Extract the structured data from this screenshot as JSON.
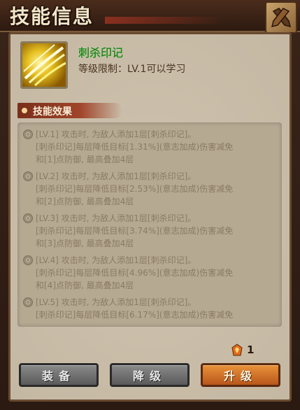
{
  "window": {
    "title": "技能信息"
  },
  "skill": {
    "name": "刺杀印记",
    "level_requirement": "等级限制：LV.1可以学习",
    "icon": "slash-claw-icon"
  },
  "section": {
    "label": "技能效果"
  },
  "effects": [
    {
      "line1": "[LV.1] 攻击时, 为敌人添加1层[刺杀印记]。",
      "line2": "[刺杀印记]每层降低目标[1.31%](意志加成)伤害减免",
      "line3": "和[1]点防御, 最高叠加4层"
    },
    {
      "line1": "[LV.2] 攻击时, 为敌人添加1层[刺杀印记]。",
      "line2": "[刺杀印记]每层降低目标[2.53%](意志加成)伤害减免",
      "line3": "和[2]点防御, 最高叠加4层"
    },
    {
      "line1": "[LV.3] 攻击时, 为敌人添加1层[刺杀印记]。",
      "line2": "[刺杀印记]每层降低目标[3.74%](意志加成)伤害减免",
      "line3": "和[3]点防御, 最高叠加4层"
    },
    {
      "line1": "[LV.4] 攻击时, 为敌人添加1层[刺杀印记]。",
      "line2": "[刺杀印记]每层降低目标[4.96%](意志加成)伤害减免",
      "line3": "和[4]点防御, 最高叠加4层"
    },
    {
      "line1": "[LV.5] 攻击时, 为敌人添加1层[刺杀印记]。",
      "line2": "[刺杀印记]每层降低目标[6.17%](意志加成)伤害减免",
      "line3": ""
    }
  ],
  "cost": {
    "icon": "skill-book-icon",
    "value": "1"
  },
  "buttons": {
    "equip": "装备",
    "downgrade": "降级",
    "upgrade": "升级"
  },
  "colors": {
    "skill_name": "#2b8a1f",
    "upgrade_button": "#d9782a",
    "gray_button": "#6e6e6e"
  }
}
